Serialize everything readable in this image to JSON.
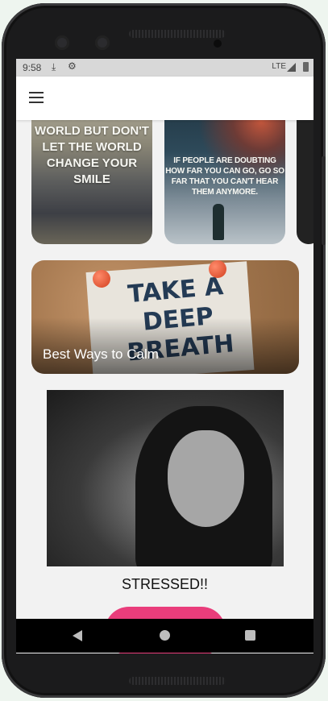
{
  "status_bar": {
    "time": "9:58",
    "network": "LTE"
  },
  "quote_cards": [
    {
      "text": "LET YOUR SMILE CHANGE THE WORLD BUT DON'T LET THE WORLD CHANGE YOUR SMILE"
    },
    {
      "text": "IF PEOPLE ARE DOUBTING HOW FAR YOU CAN GO, GO SO FAR THAT YOU CAN'T HEAR THEM ANYMORE."
    }
  ],
  "feature_card": {
    "note_text": "TAKE A DEEP BREATH",
    "title": "Best Ways to Calm"
  },
  "mood_card": {
    "caption": "STRESSED!!"
  },
  "colors": {
    "accent": "#e93d7b",
    "appbar": "#ffffff",
    "background": "#f2f2f2"
  },
  "icons": {
    "menu": "hamburger-menu-icon",
    "download": "download-icon",
    "settings": "gear-icon"
  }
}
